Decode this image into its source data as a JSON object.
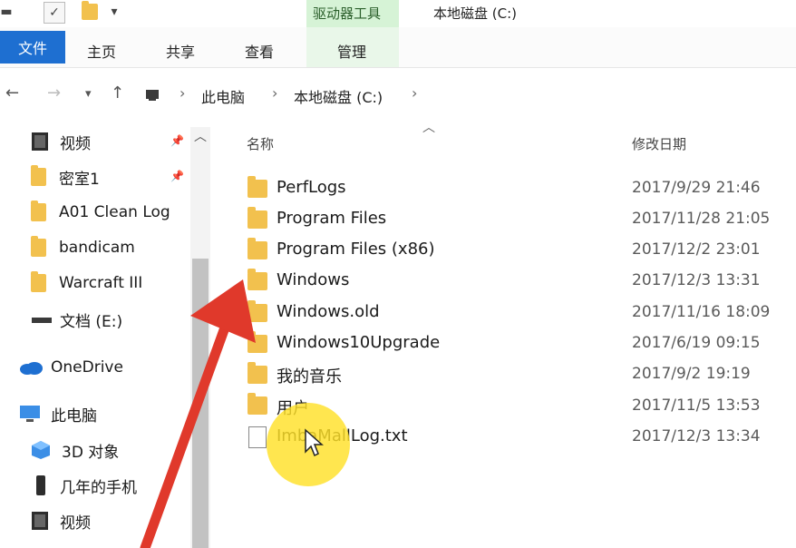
{
  "window_title": "本地磁盘 (C:)",
  "tool_context": "驱动器工具",
  "ribbon_tabs": {
    "file": "文件",
    "home": "主页",
    "share": "共享",
    "view": "查看",
    "manage": "管理"
  },
  "address": {
    "crumbs": [
      "此电脑",
      "本地磁盘 (C:)"
    ]
  },
  "sidebar": {
    "items": [
      {
        "label": "视频",
        "icon": "video-icon",
        "pinned": true
      },
      {
        "label": "密室1",
        "icon": "folder-icon",
        "pinned": true
      },
      {
        "label": "A01 Clean Log",
        "icon": "folder-icon"
      },
      {
        "label": "bandicam",
        "icon": "folder-icon"
      },
      {
        "label": "Warcraft III",
        "icon": "folder-icon"
      },
      {
        "label": "文档 (E:)",
        "icon": "drive-icon"
      },
      {
        "label": "OneDrive",
        "icon": "cloud-icon"
      },
      {
        "label": "此电脑",
        "icon": "computer-icon"
      },
      {
        "label": "3D 对象",
        "icon": "cube-icon"
      },
      {
        "label": "几年的手机",
        "icon": "phone-icon"
      },
      {
        "label": "视频",
        "icon": "video-icon"
      }
    ]
  },
  "file_list": {
    "columns": {
      "name": "名称",
      "modified": "修改日期"
    },
    "rows": [
      {
        "name": "PerfLogs",
        "date": "2017/9/29 21:46",
        "type": "folder"
      },
      {
        "name": "Program Files",
        "date": "2017/11/28 21:05",
        "type": "folder"
      },
      {
        "name": "Program Files (x86)",
        "date": "2017/12/2 23:01",
        "type": "folder"
      },
      {
        "name": "Windows",
        "date": "2017/12/3 13:31",
        "type": "folder"
      },
      {
        "name": "Windows.old",
        "date": "2017/11/16 18:09",
        "type": "folder"
      },
      {
        "name": "Windows10Upgrade",
        "date": "2017/6/19 09:15",
        "type": "folder"
      },
      {
        "name": "我的音乐",
        "date": "2017/9/2 19:19",
        "type": "folder"
      },
      {
        "name": "用户",
        "date": "2017/11/5 13:53",
        "type": "folder"
      },
      {
        "name": "ImbaMallLog.txt",
        "date": "2017/12/3 13:34",
        "type": "text"
      }
    ]
  },
  "colors": {
    "accent": "#1e6fd1",
    "folder": "#f2c14e",
    "arrow": "#e0392b",
    "highlight": "#ffe128",
    "tool_context": "#d6f3d6"
  }
}
